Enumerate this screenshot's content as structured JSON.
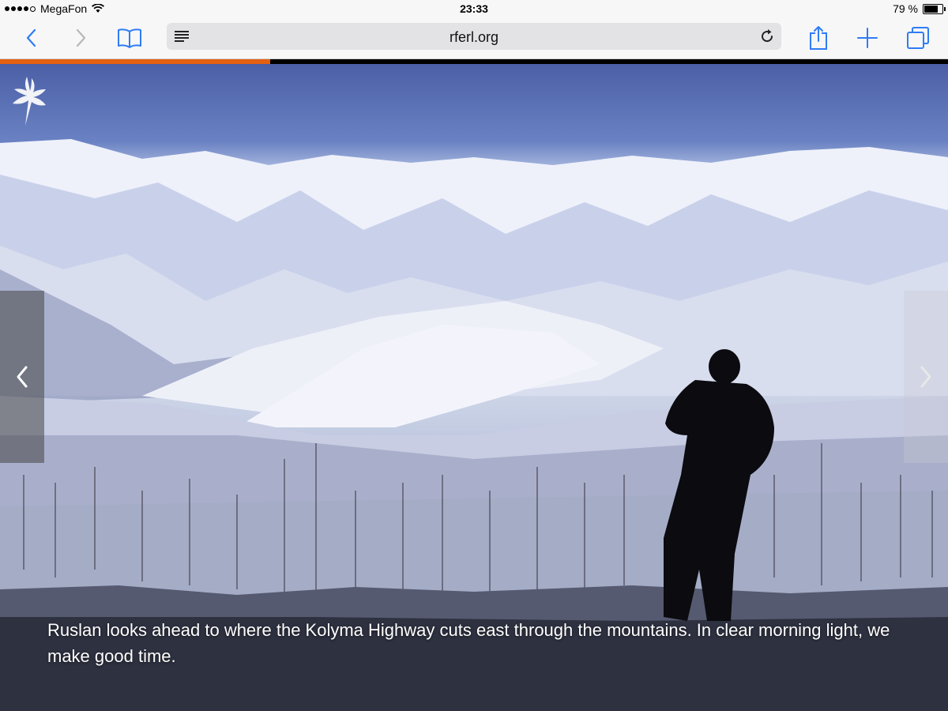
{
  "status_bar": {
    "carrier": "MegaFon",
    "time": "23:33",
    "battery": "79 %",
    "battery_level": 0.79,
    "signal_bars": 4,
    "signal_max": 5
  },
  "toolbar": {
    "url": "rferl.org",
    "icons": {
      "back": "chevron-left-icon",
      "forward": "chevron-right-icon",
      "bookmarks": "book-icon",
      "reader": "reader-icon",
      "reload": "reload-icon",
      "share": "share-icon",
      "new_tab": "plus-icon",
      "tabs": "tabs-icon"
    },
    "accent_color": "#2f7cf6"
  },
  "page_load_progress": 0.285,
  "progress_color": "#e46012",
  "gallery": {
    "caption": "Ruslan looks ahead to where the Kolyma Highway cuts east through the mountains. In clear morning light, we make good time.",
    "prev_icon": "chevron-left-icon",
    "next_icon": "chevron-right-icon",
    "logo": "rferl-torch-logo"
  }
}
